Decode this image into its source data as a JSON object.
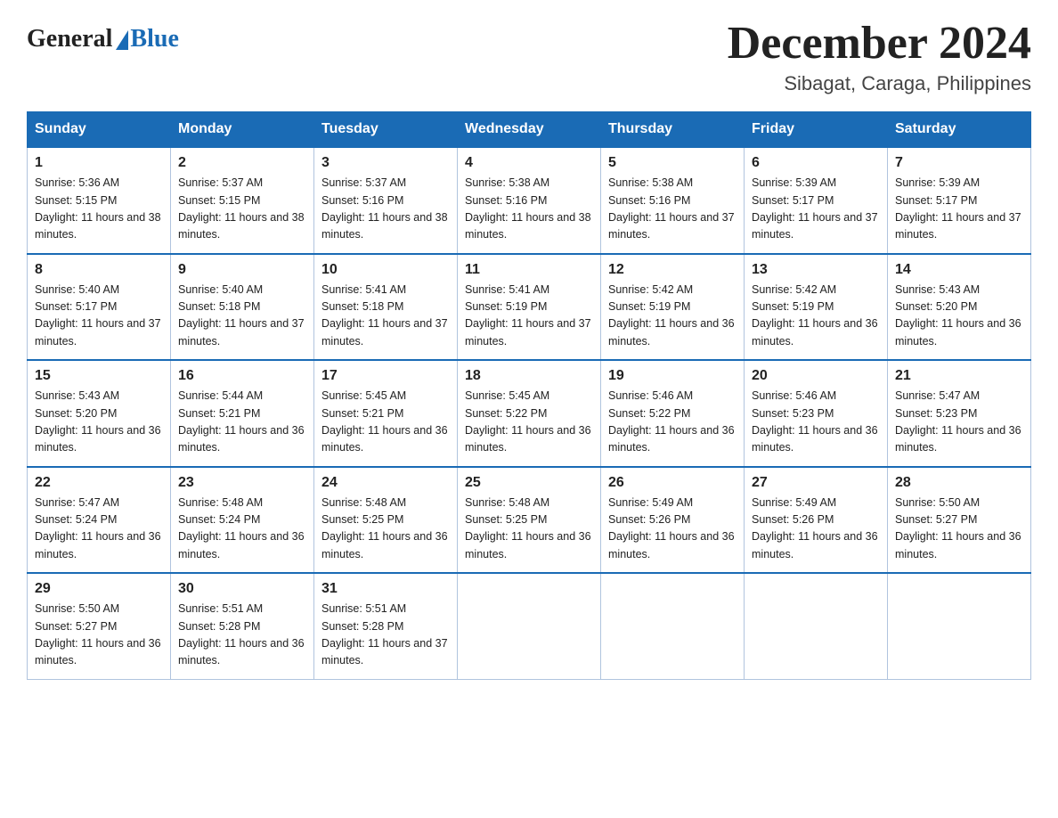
{
  "logo": {
    "general": "General",
    "blue": "Blue"
  },
  "title": "December 2024",
  "subtitle": "Sibagat, Caraga, Philippines",
  "headers": [
    "Sunday",
    "Monday",
    "Tuesday",
    "Wednesday",
    "Thursday",
    "Friday",
    "Saturday"
  ],
  "weeks": [
    [
      {
        "day": "1",
        "sunrise": "5:36 AM",
        "sunset": "5:15 PM",
        "daylight": "11 hours and 38 minutes."
      },
      {
        "day": "2",
        "sunrise": "5:37 AM",
        "sunset": "5:15 PM",
        "daylight": "11 hours and 38 minutes."
      },
      {
        "day": "3",
        "sunrise": "5:37 AM",
        "sunset": "5:16 PM",
        "daylight": "11 hours and 38 minutes."
      },
      {
        "day": "4",
        "sunrise": "5:38 AM",
        "sunset": "5:16 PM",
        "daylight": "11 hours and 38 minutes."
      },
      {
        "day": "5",
        "sunrise": "5:38 AM",
        "sunset": "5:16 PM",
        "daylight": "11 hours and 37 minutes."
      },
      {
        "day": "6",
        "sunrise": "5:39 AM",
        "sunset": "5:17 PM",
        "daylight": "11 hours and 37 minutes."
      },
      {
        "day": "7",
        "sunrise": "5:39 AM",
        "sunset": "5:17 PM",
        "daylight": "11 hours and 37 minutes."
      }
    ],
    [
      {
        "day": "8",
        "sunrise": "5:40 AM",
        "sunset": "5:17 PM",
        "daylight": "11 hours and 37 minutes."
      },
      {
        "day": "9",
        "sunrise": "5:40 AM",
        "sunset": "5:18 PM",
        "daylight": "11 hours and 37 minutes."
      },
      {
        "day": "10",
        "sunrise": "5:41 AM",
        "sunset": "5:18 PM",
        "daylight": "11 hours and 37 minutes."
      },
      {
        "day": "11",
        "sunrise": "5:41 AM",
        "sunset": "5:19 PM",
        "daylight": "11 hours and 37 minutes."
      },
      {
        "day": "12",
        "sunrise": "5:42 AM",
        "sunset": "5:19 PM",
        "daylight": "11 hours and 36 minutes."
      },
      {
        "day": "13",
        "sunrise": "5:42 AM",
        "sunset": "5:19 PM",
        "daylight": "11 hours and 36 minutes."
      },
      {
        "day": "14",
        "sunrise": "5:43 AM",
        "sunset": "5:20 PM",
        "daylight": "11 hours and 36 minutes."
      }
    ],
    [
      {
        "day": "15",
        "sunrise": "5:43 AM",
        "sunset": "5:20 PM",
        "daylight": "11 hours and 36 minutes."
      },
      {
        "day": "16",
        "sunrise": "5:44 AM",
        "sunset": "5:21 PM",
        "daylight": "11 hours and 36 minutes."
      },
      {
        "day": "17",
        "sunrise": "5:45 AM",
        "sunset": "5:21 PM",
        "daylight": "11 hours and 36 minutes."
      },
      {
        "day": "18",
        "sunrise": "5:45 AM",
        "sunset": "5:22 PM",
        "daylight": "11 hours and 36 minutes."
      },
      {
        "day": "19",
        "sunrise": "5:46 AM",
        "sunset": "5:22 PM",
        "daylight": "11 hours and 36 minutes."
      },
      {
        "day": "20",
        "sunrise": "5:46 AM",
        "sunset": "5:23 PM",
        "daylight": "11 hours and 36 minutes."
      },
      {
        "day": "21",
        "sunrise": "5:47 AM",
        "sunset": "5:23 PM",
        "daylight": "11 hours and 36 minutes."
      }
    ],
    [
      {
        "day": "22",
        "sunrise": "5:47 AM",
        "sunset": "5:24 PM",
        "daylight": "11 hours and 36 minutes."
      },
      {
        "day": "23",
        "sunrise": "5:48 AM",
        "sunset": "5:24 PM",
        "daylight": "11 hours and 36 minutes."
      },
      {
        "day": "24",
        "sunrise": "5:48 AM",
        "sunset": "5:25 PM",
        "daylight": "11 hours and 36 minutes."
      },
      {
        "day": "25",
        "sunrise": "5:48 AM",
        "sunset": "5:25 PM",
        "daylight": "11 hours and 36 minutes."
      },
      {
        "day": "26",
        "sunrise": "5:49 AM",
        "sunset": "5:26 PM",
        "daylight": "11 hours and 36 minutes."
      },
      {
        "day": "27",
        "sunrise": "5:49 AM",
        "sunset": "5:26 PM",
        "daylight": "11 hours and 36 minutes."
      },
      {
        "day": "28",
        "sunrise": "5:50 AM",
        "sunset": "5:27 PM",
        "daylight": "11 hours and 36 minutes."
      }
    ],
    [
      {
        "day": "29",
        "sunrise": "5:50 AM",
        "sunset": "5:27 PM",
        "daylight": "11 hours and 36 minutes."
      },
      {
        "day": "30",
        "sunrise": "5:51 AM",
        "sunset": "5:28 PM",
        "daylight": "11 hours and 36 minutes."
      },
      {
        "day": "31",
        "sunrise": "5:51 AM",
        "sunset": "5:28 PM",
        "daylight": "11 hours and 37 minutes."
      },
      null,
      null,
      null,
      null
    ]
  ]
}
